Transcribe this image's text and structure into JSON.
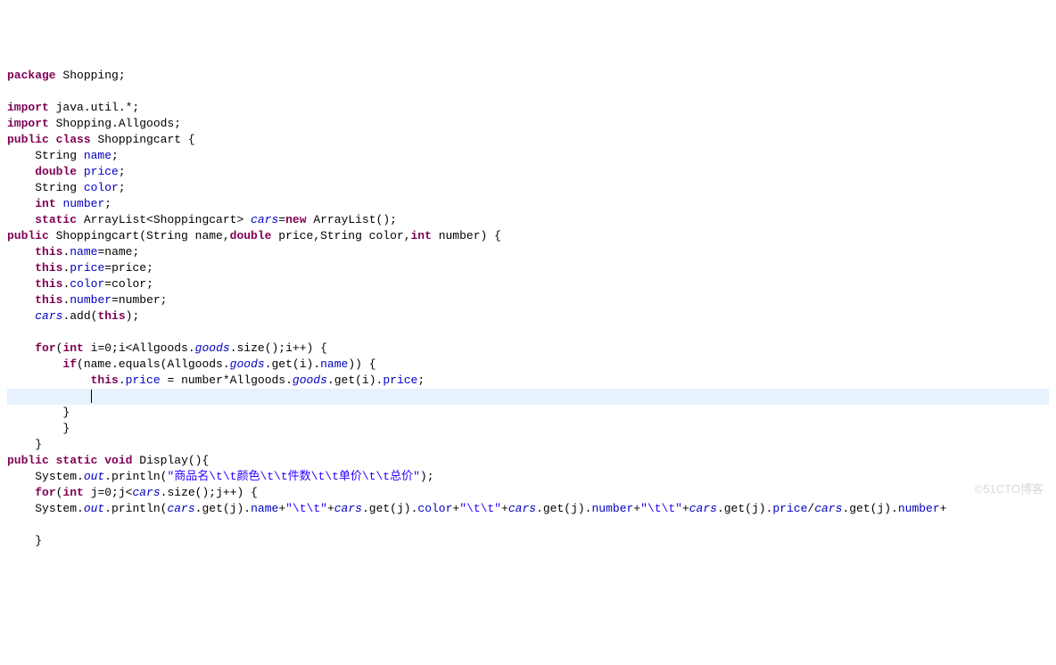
{
  "watermark": "©51CTO博客",
  "code": {
    "l1": {
      "kw_package": "package",
      "pkg": " Shopping;"
    },
    "l2": "",
    "l3": {
      "kw_import": "import",
      "rest": " java.util.*;"
    },
    "l4": {
      "kw_import": "import",
      "rest": " Shopping.Allgoods;"
    },
    "l5": {
      "kw_public": "public",
      "kw_class": "class",
      "name": " Shoppingcart {"
    },
    "l6": {
      "indent": "    ",
      "type": "String ",
      "field": "name",
      "semi": ";"
    },
    "l7": {
      "indent": "    ",
      "kw_double": "double",
      "sp": " ",
      "field": "price",
      "semi": ";"
    },
    "l8": {
      "indent": "    ",
      "type": "String ",
      "field": "color",
      "semi": ";"
    },
    "l9": {
      "indent": "    ",
      "kw_int": "int",
      "sp": " ",
      "field": "number",
      "semi": ";"
    },
    "l10": {
      "indent": "    ",
      "kw_static": "static",
      "rest1": " ArrayList<Shoppingcart> ",
      "field": "cars",
      "eq": "=",
      "kw_new": "new",
      "rest2": " ArrayList();"
    },
    "l11": {
      "kw_public": "public",
      "rest1": " Shoppingcart(String name,",
      "kw_double": "double",
      "rest2": " price,String color,",
      "kw_int": "int",
      "rest3": " number) {"
    },
    "l12": {
      "indent": "    ",
      "kw_this": "this",
      "dot": ".",
      "field": "name",
      "rest": "=name;"
    },
    "l13": {
      "indent": "    ",
      "kw_this": "this",
      "dot": ".",
      "field": "price",
      "rest": "=price;"
    },
    "l14": {
      "indent": "    ",
      "kw_this": "this",
      "dot": ".",
      "field": "color",
      "rest": "=color;"
    },
    "l15": {
      "indent": "    ",
      "kw_this": "this",
      "dot": ".",
      "field": "number",
      "rest": "=number;"
    },
    "l16": {
      "indent": "    ",
      "field": "cars",
      "rest1": ".add(",
      "kw_this": "this",
      "rest2": ");"
    },
    "l17": "",
    "l18": {
      "indent": "    ",
      "kw_for": "for",
      "p1": "(",
      "kw_int": "int",
      "rest1": " i=0;i<Allgoods.",
      "field": "goods",
      "rest2": ".size();i++) {"
    },
    "l19": {
      "indent": "        ",
      "kw_if": "if",
      "rest1": "(name.equals(Allgoods.",
      "field": "goods",
      "rest2": ".get(i).",
      "field2": "name",
      "rest3": ")) {"
    },
    "l20": {
      "indent": "            ",
      "kw_this": "this",
      "dot": ".",
      "field": "price",
      "rest1": " = number*Allgoods.",
      "field2": "goods",
      "rest2": ".get(i).",
      "field3": "price",
      "semi": ";"
    },
    "l21": {
      "indent": "            "
    },
    "l22": {
      "indent": "        ",
      "brace": "}"
    },
    "l23": {
      "indent": "        ",
      "brace": "}"
    },
    "l24": {
      "indent": "    ",
      "brace": "}"
    },
    "l25": {
      "kw_public": "public",
      "sp1": " ",
      "kw_static": "static",
      "sp2": " ",
      "kw_void": "void",
      "rest": " Display(){"
    },
    "l26": {
      "indent": "    ",
      "rest1": "System.",
      "field": "out",
      "rest2": ".println(",
      "str": "\"商品名\\t\\t颜色\\t\\t件数\\t\\t单价\\t\\t总价\"",
      "rest3": ");"
    },
    "l27": {
      "indent": "    ",
      "kw_for": "for",
      "p1": "(",
      "kw_int": "int",
      "rest1": " j=0;j<",
      "field": "cars",
      "rest2": ".size();j++) {"
    },
    "l28": {
      "indent": "    ",
      "rest1": "System.",
      "field_out": "out",
      "rest2": ".println(",
      "field_cars1": "cars",
      "rest3": ".get(j).",
      "field_name": "name",
      "plus1": "+",
      "str1": "\"\\t\\t\"",
      "plus2": "+",
      "field_cars2": "cars",
      "rest4": ".get(j).",
      "field_color": "color",
      "plus3": "+",
      "str2": "\"\\t\\t\"",
      "plus4": "+",
      "field_cars3": "cars",
      "rest5": ".get(j).",
      "field_number": "number",
      "plus5": "+",
      "str3": "\"\\t\\t\"",
      "plus6": "+",
      "field_cars4": "cars",
      "rest6": ".get(j).",
      "field_price": "price",
      "slash": "/",
      "field_cars5": "cars",
      "rest7": ".get(j).",
      "field_number2": "number",
      "plus7": "+"
    },
    "l29": "",
    "l30": {
      "indent": "    ",
      "brace": "}"
    }
  }
}
